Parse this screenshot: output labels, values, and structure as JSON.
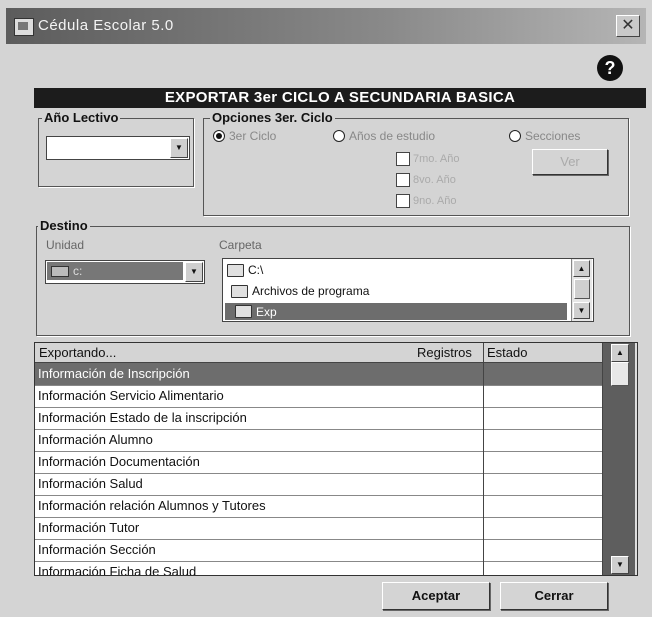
{
  "window": {
    "title": "Cédula Escolar 5.0",
    "close_glyph": "✕",
    "help_glyph": "?"
  },
  "header": {
    "title": "EXPORTAR 3er CICLO A SECUNDARIA BASICA"
  },
  "anio_lectivo": {
    "legend": "Año Lectivo",
    "value": "",
    "dropdown_glyph": "▼"
  },
  "opciones": {
    "legend": "Opciones 3er. Ciclo",
    "radios": [
      {
        "label": "3er Ciclo",
        "checked": true
      },
      {
        "label": "Años de estudio",
        "checked": false
      },
      {
        "label": "Secciones",
        "checked": false
      }
    ],
    "checkboxes": [
      {
        "label": "7mo. Año",
        "checked": false
      },
      {
        "label": "8vo. Año",
        "checked": false
      },
      {
        "label": "9no. Año",
        "checked": false
      }
    ],
    "ver_button": "Ver"
  },
  "destino": {
    "legend": "Destino",
    "unidad_label": "Unidad",
    "unidad_value": "c:",
    "carpeta_label": "Carpeta",
    "folders": [
      {
        "name": "C:\\",
        "selected": false,
        "icon": "folder-open-icon"
      },
      {
        "name": "Archivos de programa",
        "selected": false,
        "icon": "folder-open-icon"
      },
      {
        "name": "Exp",
        "selected": true,
        "icon": "folder-open-icon"
      }
    ]
  },
  "table": {
    "columns": [
      "Exportando...",
      "Registros",
      "Estado"
    ],
    "rows": [
      {
        "label": "Información de Inscripción",
        "registros": "",
        "estado": "",
        "selected": true
      },
      {
        "label": "Información Servicio Alimentario",
        "registros": "",
        "estado": "",
        "selected": false
      },
      {
        "label": "Información Estado de la inscripción",
        "registros": "",
        "estado": "",
        "selected": false
      },
      {
        "label": "Información Alumno",
        "registros": "",
        "estado": "",
        "selected": false
      },
      {
        "label": "Información Documentación",
        "registros": "",
        "estado": "",
        "selected": false
      },
      {
        "label": "Información Salud",
        "registros": "",
        "estado": "",
        "selected": false
      },
      {
        "label": "Información relación Alumnos y Tutores",
        "registros": "",
        "estado": "",
        "selected": false
      },
      {
        "label": "Información Tutor",
        "registros": "",
        "estado": "",
        "selected": false
      },
      {
        "label": "Información Sección",
        "registros": "",
        "estado": "",
        "selected": false
      },
      {
        "label": "Información Ficha de Salud",
        "registros": "",
        "estado": "",
        "selected": false
      }
    ],
    "scroll_up_glyph": "▲",
    "scroll_down_glyph": "▼"
  },
  "buttons": {
    "accept": "Aceptar",
    "close": "Cerrar"
  }
}
